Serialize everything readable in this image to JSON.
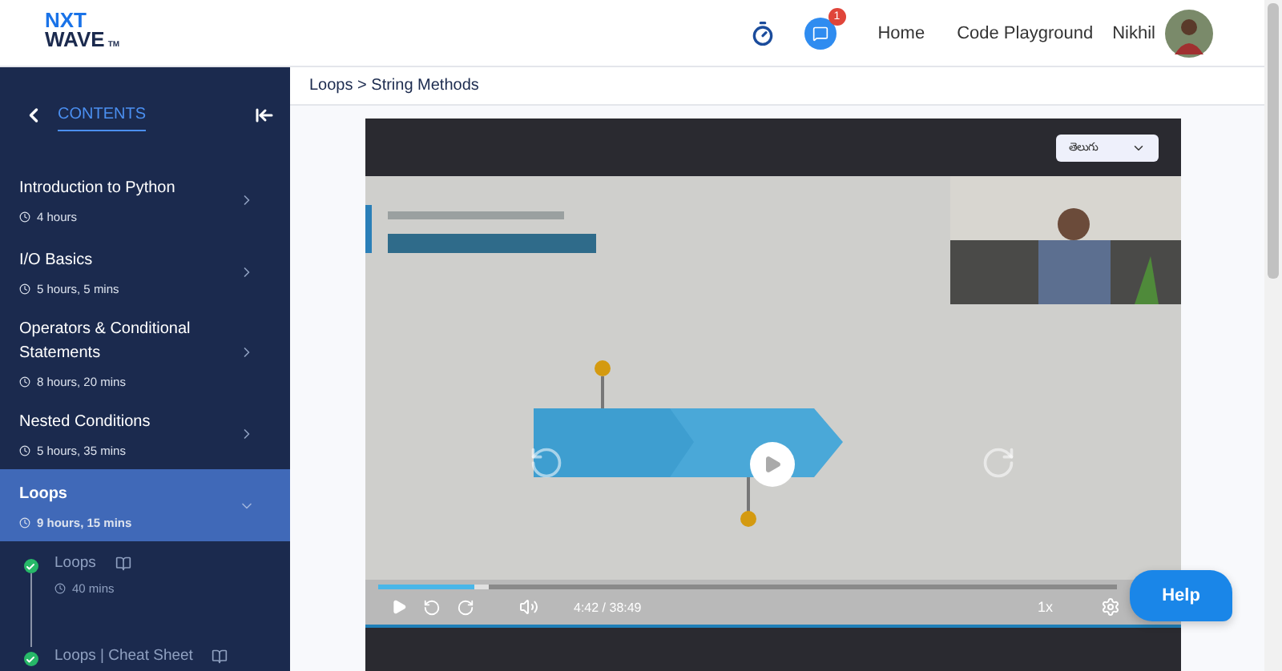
{
  "header": {
    "logo": {
      "line1": "NXT",
      "line2": "WAVE",
      "mark": "TM"
    },
    "notifications_badge": "1",
    "nav": [
      "Home",
      "Code Playground"
    ],
    "user_name": "Nikhil"
  },
  "sidebar": {
    "title": "CONTENTS",
    "items": [
      {
        "title": "Introduction to Python",
        "duration": "4 hours",
        "selected": false,
        "expanded": false
      },
      {
        "title": "I/O Basics",
        "duration": "5 hours, 5 mins",
        "selected": false,
        "expanded": false
      },
      {
        "title": "Operators & Conditional Statements",
        "duration": "8 hours, 20 mins",
        "selected": false,
        "expanded": false
      },
      {
        "title": "Nested Conditions",
        "duration": "5 hours, 35 mins",
        "selected": false,
        "expanded": false
      },
      {
        "title": "Loops",
        "duration": "9 hours, 15 mins",
        "selected": true,
        "expanded": true,
        "children": [
          {
            "title": "Loops",
            "duration": "40 mins",
            "completed": true
          },
          {
            "title": "Loops | Cheat Sheet",
            "completed": true
          }
        ]
      }
    ]
  },
  "breadcrumb": "Loops > String Methods",
  "player": {
    "language": "తెలుగు",
    "progress": {
      "level": 0.13
    },
    "buffer": {
      "level": 0.15
    },
    "time": "4:42 / 38:49",
    "speed": "1x"
  },
  "help_button": "Help"
}
